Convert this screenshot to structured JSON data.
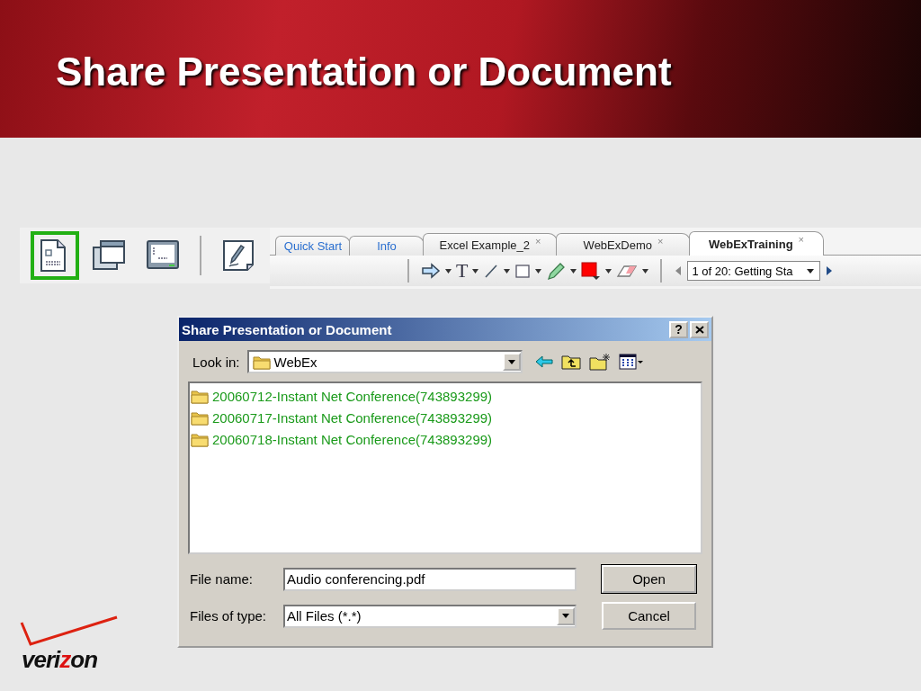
{
  "slide_title": "Share Presentation or Document",
  "toolbar": {
    "buttons": [
      {
        "kind": "document",
        "selected": true
      },
      {
        "kind": "application",
        "selected": false
      },
      {
        "kind": "desktop",
        "selected": false
      },
      {
        "kind": "whiteboard",
        "selected": false
      }
    ]
  },
  "tabs": [
    {
      "label": "Quick Start",
      "kind": "panel",
      "selected": false
    },
    {
      "label": "Info",
      "kind": "panel",
      "selected": false
    },
    {
      "label": "Excel Example_2",
      "kind": "document",
      "selected": false,
      "close": "×"
    },
    {
      "label": "WebExDemo",
      "kind": "document",
      "selected": false,
      "close": "×"
    },
    {
      "label": "WebExTraining",
      "kind": "document",
      "selected": true,
      "close": "×"
    }
  ],
  "annotation_tools": [
    {
      "kind": "arrow"
    },
    {
      "kind": "text",
      "label": "T"
    },
    {
      "kind": "line"
    },
    {
      "kind": "rectangle"
    },
    {
      "kind": "highlighter"
    },
    {
      "kind": "color"
    },
    {
      "kind": "eraser"
    }
  ],
  "slide_selector": {
    "value": "1 of 20: Getting Sta"
  },
  "dialog": {
    "title": "Share Presentation or Document",
    "help": "?",
    "look_in": {
      "label": "Look in:",
      "value": "WebEx"
    },
    "files": [
      {
        "name": "20060712-Instant Net Conference(743893299)"
      },
      {
        "name": "20060717-Instant Net Conference(743893299)"
      },
      {
        "name": "20060718-Instant Net Conference(743893299)"
      }
    ],
    "file_name": {
      "label": "File name:",
      "value": "Audio conferencing.pdf"
    },
    "file_type": {
      "label": "Files of type:",
      "value": "All Files (*.*)"
    },
    "buttons": [
      {
        "label": "Open",
        "kind": "default"
      },
      {
        "label": "Cancel",
        "kind": "normal"
      }
    ]
  },
  "logo": {
    "parts": [
      {
        "text": "veri",
        "accent": false
      },
      {
        "text": "z",
        "accent": true
      },
      {
        "text": "on",
        "accent": false
      }
    ]
  }
}
